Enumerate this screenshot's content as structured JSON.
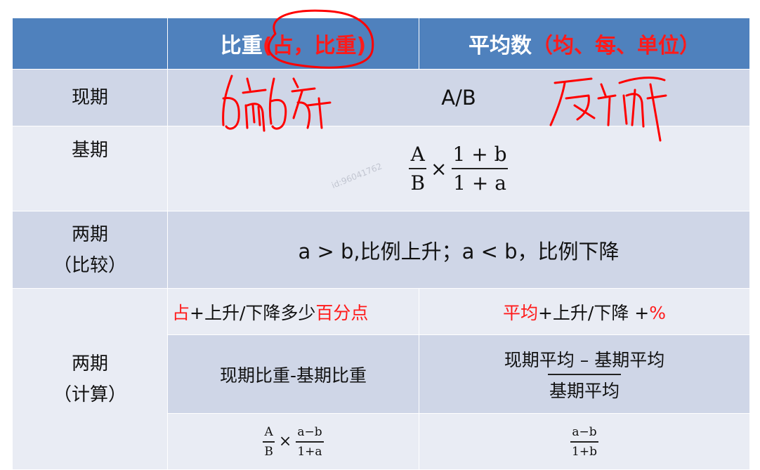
{
  "header": {
    "col_ratio_main": "比重",
    "col_ratio_paren": "(占，比重)",
    "col_avg_main": "平均数",
    "col_avg_paren": "（均、每、单位）"
  },
  "rows": {
    "current": {
      "label": "现期",
      "formula": "A/B"
    },
    "base": {
      "label": "基期",
      "formula": {
        "left_num": "A",
        "left_den": "B",
        "times": "×",
        "right_num": "1 + b",
        "right_den": "1 + a"
      }
    },
    "compare": {
      "label_line1": "两期",
      "label_line2": "（比较）",
      "text": "a > b,比例上升；a < b，比例下降"
    },
    "calc": {
      "label_line1": "两期",
      "label_line2": "（计算）",
      "ratio_desc": {
        "red1": "占",
        "mid": "+上升/下降多少",
        "red2": "百分点"
      },
      "avg_desc": {
        "red1": "平均",
        "mid": "+上升/下降 +",
        "red2": "%"
      },
      "ratio_formula": "现期比重-基期比重",
      "avg_formula": {
        "num": "现期平均 – 基期平均",
        "den": "基期平均"
      },
      "ratio_expr": {
        "left_num": "A",
        "left_den": "B",
        "times": "×",
        "right_num": "a−b",
        "right_den": "1+a"
      },
      "avg_expr": {
        "num": "a−b",
        "den": "1+b"
      }
    }
  },
  "watermark": "id:96041762",
  "annotations": {
    "color": "#ff0000"
  }
}
